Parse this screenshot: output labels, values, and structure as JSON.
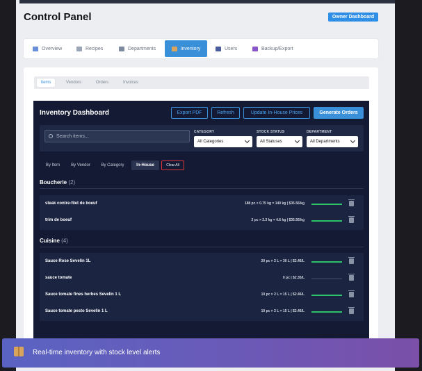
{
  "app": {
    "title": "Control Panel",
    "owner_button": "Owner Dashboard"
  },
  "tabs": [
    {
      "label": "Overview",
      "icon": "chart-icon"
    },
    {
      "label": "Recipes",
      "icon": "book-icon"
    },
    {
      "label": "Departments",
      "icon": "building-icon"
    },
    {
      "label": "Inventory",
      "icon": "box-icon",
      "active": true
    },
    {
      "label": "Users",
      "icon": "users-icon"
    },
    {
      "label": "Backup/Export",
      "icon": "floppy-icon"
    }
  ],
  "subtabs": [
    {
      "label": "Items",
      "active": true
    },
    {
      "label": "Vendors"
    },
    {
      "label": "Orders"
    },
    {
      "label": "Invoices"
    }
  ],
  "dashboard": {
    "title": "Inventory Dashboard",
    "buttons": {
      "export_pdf": "Export PDF",
      "refresh": "Refresh",
      "update_prices": "Update In-House Prices",
      "generate_orders": "Generate Orders"
    },
    "search_placeholder": "Search items...",
    "filters": {
      "category_label": "CATEGORY",
      "category_value": "All Categories",
      "status_label": "STOCK STATUS",
      "status_value": "All Statuses",
      "department_label": "DEPARTMENT",
      "department_value": "All Departments"
    },
    "group_buttons": [
      "By Item",
      "By Vendor",
      "By Category",
      "In-House"
    ],
    "active_group": "In-House",
    "clear_all": "Clear All",
    "categories": [
      {
        "name": "Boucherie",
        "count": "(2)",
        "items": [
          {
            "name": "steak contre-filet de boeuf",
            "qty": "188 pc × 0.75 kg = 140 kg | $35.56/kg",
            "level": 1.0
          },
          {
            "name": "trim de boeuf",
            "qty": "2 pc × 2.3 kg = 4.6 kg | $35.56/kg",
            "level": 1.0
          }
        ]
      },
      {
        "name": "Cuisine",
        "count": "(4)",
        "items": [
          {
            "name": "Sauce Rose Sevelin 1L",
            "qty": "20 pc × 2 L = 30 L | $2.46/L",
            "level": 1.0
          },
          {
            "name": "sauce tomate",
            "qty": "0 pc | $2.35/L",
            "level": 0.0
          },
          {
            "name": "Sauce tomate fines herbes Sevelin 1 L",
            "qty": "10 pc × 2 L = 15 L | $2.46/L",
            "level": 1.0
          },
          {
            "name": "Sauce tomate pesto Sevelin 1 L",
            "qty": "10 pc × 2 L = 15 L | $2.46/L",
            "level": 1.0
          }
        ]
      }
    ]
  },
  "caption": {
    "icon": "package-icon",
    "text": "Real-time inventory with stock level alerts"
  },
  "colors": {
    "accent": "#3a8fd9",
    "dashboard_bg": "#141a33",
    "stock_ok": "#2ec36b",
    "clear_red": "#e0343c"
  }
}
